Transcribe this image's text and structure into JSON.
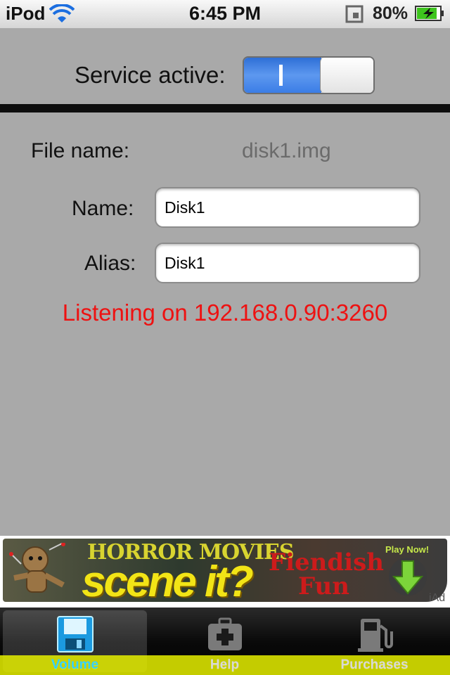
{
  "status_bar": {
    "carrier": "iPod",
    "time": "6:45 PM",
    "battery_percent": "80%"
  },
  "service": {
    "label": "Service active:",
    "toggle_on": true,
    "toggle_mark": "I"
  },
  "form": {
    "file_name_label": "File name:",
    "file_name_value": "disk1.img",
    "name_label": "Name:",
    "name_value": "Disk1",
    "alias_label": "Alias:",
    "alias_value": "Disk1",
    "status_message": "Listening on 192.168.0.90:3260"
  },
  "ad": {
    "line1": "HORROR MOVIES",
    "line2": "scene it?",
    "tagline1": "Fiendish",
    "tagline2": "Fun",
    "play_now": "Play Now!",
    "iad": "iAd"
  },
  "tabs": [
    {
      "label": "Volume",
      "icon": "floppy-disk-icon",
      "selected": true
    },
    {
      "label": "Help",
      "icon": "first-aid-kit-icon",
      "selected": false
    },
    {
      "label": "Purchases",
      "icon": "fuel-pump-icon",
      "selected": false
    }
  ],
  "colors": {
    "background": "#a9a9a9",
    "status_message": "#ee1111",
    "toggle_on": "#3b7de6",
    "tab_selected": "#35d0ff",
    "tab_highlight": "#e6f000"
  }
}
